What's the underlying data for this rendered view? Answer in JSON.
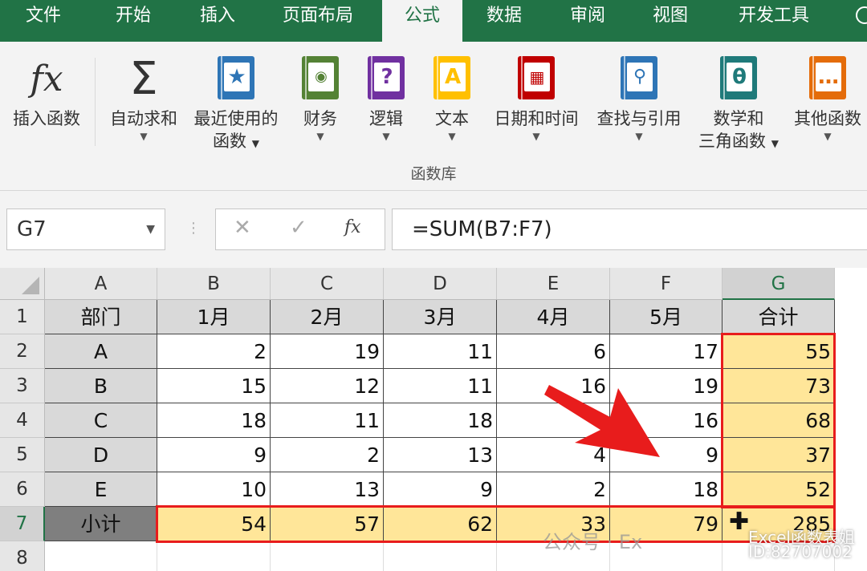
{
  "tabs": [
    "文件",
    "开始",
    "插入",
    "页面布局",
    "公式",
    "数据",
    "审阅",
    "视图",
    "开发工具"
  ],
  "active_tab": "公式",
  "ribbon": {
    "insert_function": {
      "icon": "fx",
      "label": "插入函数"
    },
    "autosum": {
      "icon": "Σ",
      "label": "自动求和"
    },
    "recent": {
      "label1": "最近使用的",
      "label2": "函数"
    },
    "financial": {
      "label": "财务"
    },
    "logical": {
      "label": "逻辑",
      "glyph": "?"
    },
    "text": {
      "label": "文本",
      "glyph": "A"
    },
    "datetime": {
      "label": "日期和时间"
    },
    "lookup": {
      "label": "查找与引用"
    },
    "math": {
      "label1": "数学和",
      "label2": "三角函数",
      "glyph": "θ"
    },
    "more": {
      "label": "其他函数",
      "glyph": "…"
    },
    "group_label": "函数库",
    "colors": {
      "blue": "#2e75b6",
      "green": "#548235",
      "purple": "#7030a0",
      "yellow": "#ffc000",
      "red": "#c00000",
      "teal": "#1f7a7a",
      "orange": "#e46c0a"
    }
  },
  "formula_bar": {
    "name_box": "G7",
    "cancel": "✕",
    "enter": "✓",
    "fx": "fx",
    "formula": "=SUM(B7:F7)"
  },
  "sheet": {
    "columns": [
      "A",
      "B",
      "C",
      "D",
      "E",
      "F",
      "G"
    ],
    "rows": [
      "1",
      "2",
      "3",
      "4",
      "5",
      "6",
      "7",
      "8"
    ],
    "header_row": [
      "部门",
      "1月",
      "2月",
      "3月",
      "4月",
      "5月",
      "合计"
    ],
    "data": [
      [
        "A",
        "2",
        "19",
        "11",
        "6",
        "17",
        "55"
      ],
      [
        "B",
        "15",
        "12",
        "11",
        "16",
        "19",
        "73"
      ],
      [
        "C",
        "18",
        "11",
        "18",
        "",
        "16",
        "68"
      ],
      [
        "D",
        "9",
        "2",
        "13",
        "4",
        "9",
        "37"
      ],
      [
        "E",
        "10",
        "13",
        "9",
        "2",
        "18",
        "52"
      ],
      [
        "小计",
        "54",
        "57",
        "62",
        "33",
        "79",
        "285"
      ]
    ]
  },
  "watermark": {
    "text1": "公众号 · Ex",
    "text2": "Excel函数表姐",
    "text3": "ID:82707002"
  },
  "accent_colors": {
    "excel_green": "#217346",
    "highlight": "#ffe699",
    "red": "#e81c1c"
  }
}
